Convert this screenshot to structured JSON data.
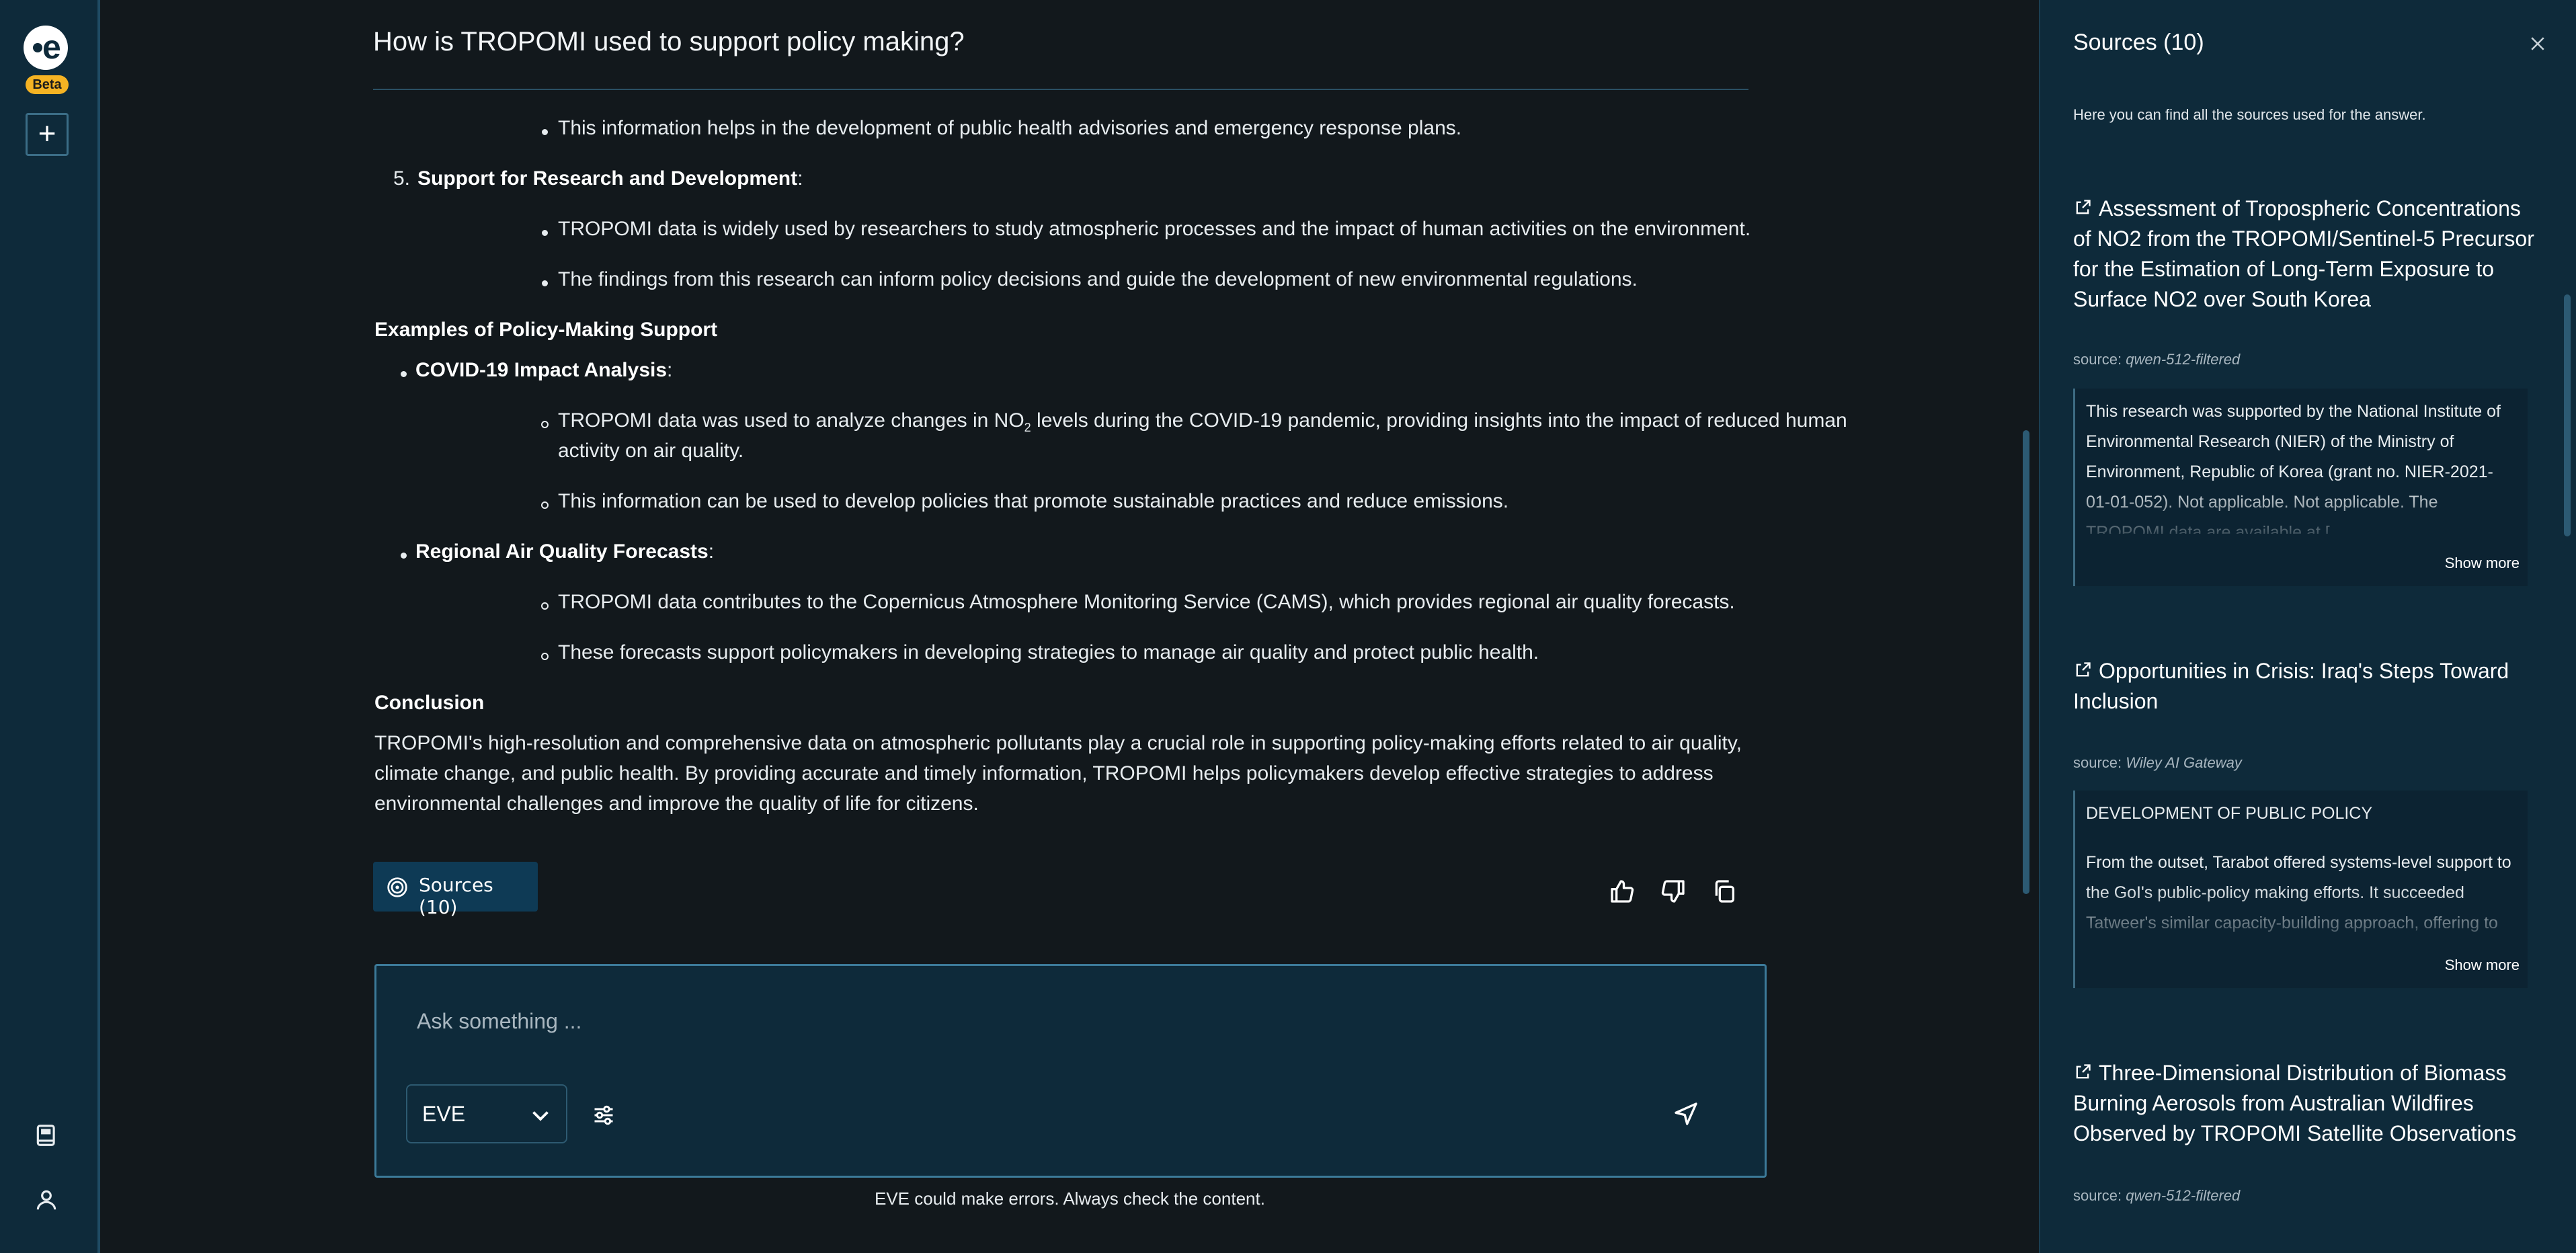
{
  "rail": {
    "beta": "Beta",
    "new_chat": "+"
  },
  "question": "How is TROPOMI used to support policy making?",
  "answer": {
    "l1": "This information helps in the development of public health advisories and emergency response plans.",
    "n5_num": "5.",
    "n5_bold": "Support for Research and Development",
    "n5_tail": ":",
    "l2": "TROPOMI data is widely used by researchers to study atmospheric processes and the impact of human activities on the environment.",
    "l3": "The findings from this research can inform policy decisions and guide the development of new environmental regulations.",
    "h_examples": "Examples of Policy-Making Support",
    "covid_bold": "COVID-19 Impact Analysis",
    "covid_tail": ":",
    "covid_1a": "TROPOMI data was used to analyze changes in NO",
    "covid_1sub": "2",
    "covid_1b": " levels during the COVID-19 pandemic, providing insights into the impact of reduced human",
    "covid_1c": "activity on air quality.",
    "covid_2": "This information can be used to develop policies that promote sustainable practices and reduce emissions.",
    "regional_bold": "Regional Air Quality Forecasts",
    "regional_tail": ":",
    "regional_1": "TROPOMI data contributes to the Copernicus Atmosphere Monitoring Service (CAMS), which provides regional air quality forecasts.",
    "regional_2": "These forecasts support policymakers in developing strategies to manage air quality and protect public health.",
    "h_conclusion": "Conclusion",
    "conc_1": "TROPOMI's high-resolution and comprehensive data on atmospheric pollutants play a crucial role in supporting policy-making efforts related to air quality,",
    "conc_2": "climate change, and public health. By providing accurate and timely information, TROPOMI helps policymakers develop effective strategies to address",
    "conc_3": "environmental challenges and improve the quality of life for citizens."
  },
  "sources_button": "Sources (10)",
  "chat": {
    "placeholder": "Ask something ...",
    "model": "EVE",
    "disclaimer": "EVE could make errors. Always check the content."
  },
  "panel": {
    "title": "Sources (10)",
    "subtitle": "Here you can find all the sources used for the answer.",
    "sources": [
      {
        "title": "Assessment of Tropospheric Concentrations of NO2 from the TROPOMI/Sentinel-5 Precursor for the Estimation of Long-Term Exposure to Surface NO2 over South Korea",
        "meta_prefix": "source: ",
        "meta": "qwen-512-filtered",
        "excerpt": "This research was supported by the National Institute of Environmental Research (NIER) of the Ministry of Environment, Republic of Korea (grant no. NIER-2021-01-01-052). Not applicable. Not applicable. The TROPOMI data are available at [",
        "show_more": "Show more"
      },
      {
        "title": "Opportunities in Crisis: Iraq's Steps Toward Inclusion",
        "meta_prefix": "source: ",
        "meta": "Wiley AI Gateway",
        "excerpt_head": "DEVELOPMENT OF PUBLIC POLICY",
        "excerpt": "From the outset, Tarabot offered systems-level support to the GoI's public-policy making efforts. It succeeded Tatweer's similar capacity-building approach, offering to",
        "show_more": "Show more"
      },
      {
        "title": "Three-Dimensional Distribution of Biomass Burning Aerosols from Australian Wildfires Observed by TROPOMI Satellite Observations",
        "meta_prefix": "source: ",
        "meta": "qwen-512-filtered"
      }
    ]
  },
  "colors": {
    "rail_bg": "#0e2a3a",
    "main_bg": "#12181c",
    "panel_bg": "#0e2a3a",
    "accent": "#3c7a99",
    "beta": "#f5b323"
  }
}
